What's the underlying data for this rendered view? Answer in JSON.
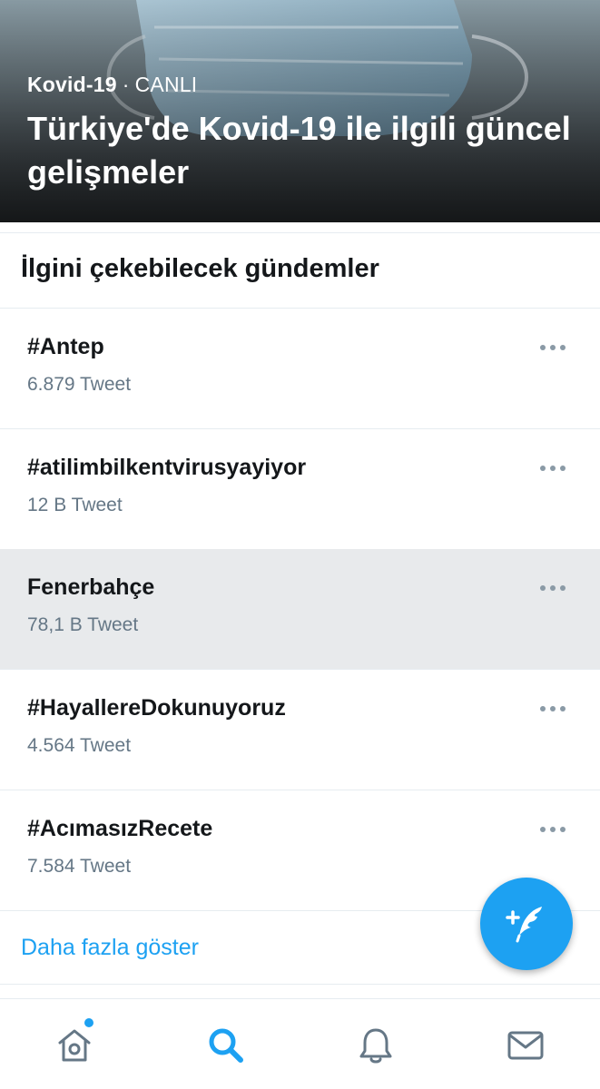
{
  "hero": {
    "category": "Kovid-19",
    "separator": "·",
    "status": "CANLI",
    "title": "Türkiye'de Kovid-19 ile ilgili güncel gelişmeler"
  },
  "section": {
    "title": "İlgini çekebilecek gündemler"
  },
  "trends": [
    {
      "name": "#Antep",
      "count": "6.879 Tweet",
      "highlighted": false
    },
    {
      "name": "#atilimbilkentvirusyayiyor",
      "count": "12 B Tweet",
      "highlighted": false
    },
    {
      "name": "Fenerbahçe",
      "count": "78,1 B Tweet",
      "highlighted": true
    },
    {
      "name": "#HayallereDokunuyoruz",
      "count": "4.564 Tweet",
      "highlighted": false
    },
    {
      "name": "#AcımasızRecete",
      "count": "7.584 Tweet",
      "highlighted": false
    }
  ],
  "show_more": "Daha fazla göster",
  "fab": {
    "icon": "compose-tweet-icon"
  },
  "tabbar": [
    {
      "icon": "home-icon",
      "active": false,
      "has_dot": true
    },
    {
      "icon": "search-icon",
      "active": true,
      "has_dot": false
    },
    {
      "icon": "bell-icon",
      "active": false,
      "has_dot": false
    },
    {
      "icon": "mail-icon",
      "active": false,
      "has_dot": false
    }
  ],
  "colors": {
    "accent": "#1da1f2",
    "text_primary": "#14171a",
    "text_secondary": "#657786",
    "divider": "#e6ecf0",
    "highlight_row": "#e8eaec",
    "icon_inactive": "#657786"
  }
}
